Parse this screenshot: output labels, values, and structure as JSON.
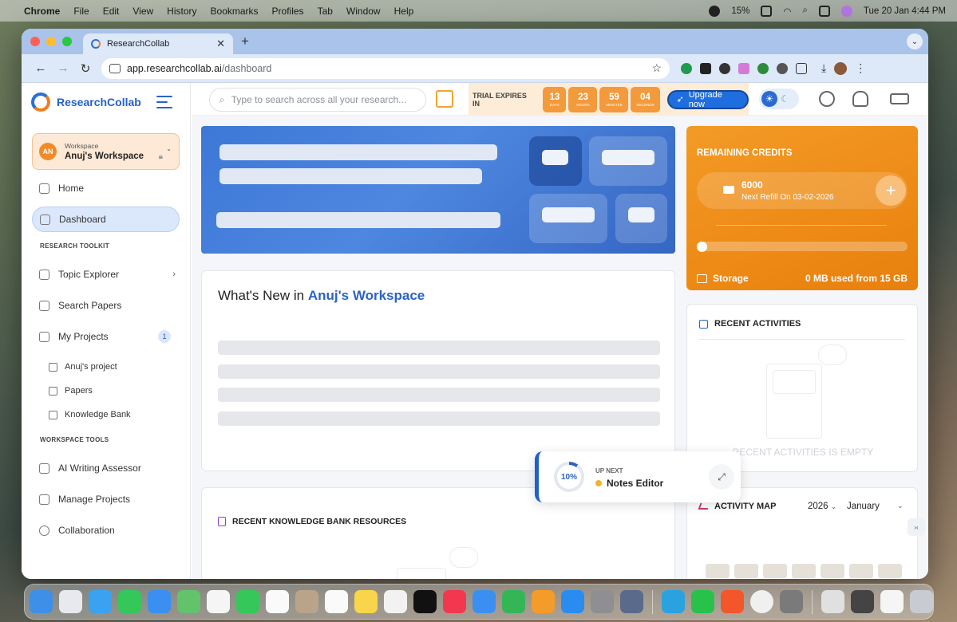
{
  "menubar": {
    "items": [
      "Chrome",
      "File",
      "Edit",
      "View",
      "History",
      "Bookmarks",
      "Profiles",
      "Tab",
      "Window",
      "Help"
    ],
    "battery": "15%",
    "clock": "Tue 20 Jan  4:44 PM"
  },
  "browser": {
    "tab_title": "ResearchCollab",
    "url_host": "app.researchcollab.ai",
    "url_path": "/dashboard"
  },
  "sidebar": {
    "brand": "ResearchCollab",
    "workspace_label": "Workspace",
    "workspace_name": "Anuj's Workspace",
    "avatar_initials": "AN",
    "home": "Home",
    "dashboard": "Dashboard",
    "section_toolkit": "RESEARCH TOOLKIT",
    "topic_explorer": "Topic Explorer",
    "search_papers": "Search Papers",
    "my_projects": "My Projects",
    "my_projects_count": "1",
    "project_name": "Anuj's project",
    "papers": "Papers",
    "knowledge_bank": "Knowledge Bank",
    "section_tools": "WORKSPACE TOOLS",
    "ai_writing": "AI Writing Assessor",
    "manage_projects": "Manage Projects",
    "collaboration": "Collaboration"
  },
  "topbar": {
    "search_placeholder": "Type to search across all your research...",
    "trial_label": "TRIAL EXPIRES IN",
    "days": "13",
    "days_label": "DAYS",
    "hours": "23",
    "hours_label": "HOURS",
    "minutes": "59",
    "minutes_label": "MINUTES",
    "seconds": "04",
    "seconds_label": "SECONDS",
    "upgrade": "Upgrade now"
  },
  "credits": {
    "title": "REMAINING CREDITS",
    "amount": "6000",
    "refill": "Next Refill On 03-02-2026",
    "storage_label": "Storage",
    "storage_value": "0 MB used from 15 GB",
    "storage_fraction": 0
  },
  "whats_new": {
    "prefix": "What's New in ",
    "workspace": "Anuj's Workspace"
  },
  "recent_activities": {
    "title": "RECENT ACTIVITIES",
    "empty": "RECENT ACTIVITIES IS EMPTY"
  },
  "knowledge_resources": {
    "title": "RECENT KNOWLEDGE BANK RESOURCES"
  },
  "activity_map": {
    "title": "ACTIVITY MAP",
    "year": "2026",
    "month": "January"
  },
  "up_next": {
    "progress": "10%",
    "label": "UP NEXT",
    "title": "Notes Editor"
  },
  "colors": {
    "brand_blue": "#2a63c6",
    "orange": "#ee8a16"
  }
}
